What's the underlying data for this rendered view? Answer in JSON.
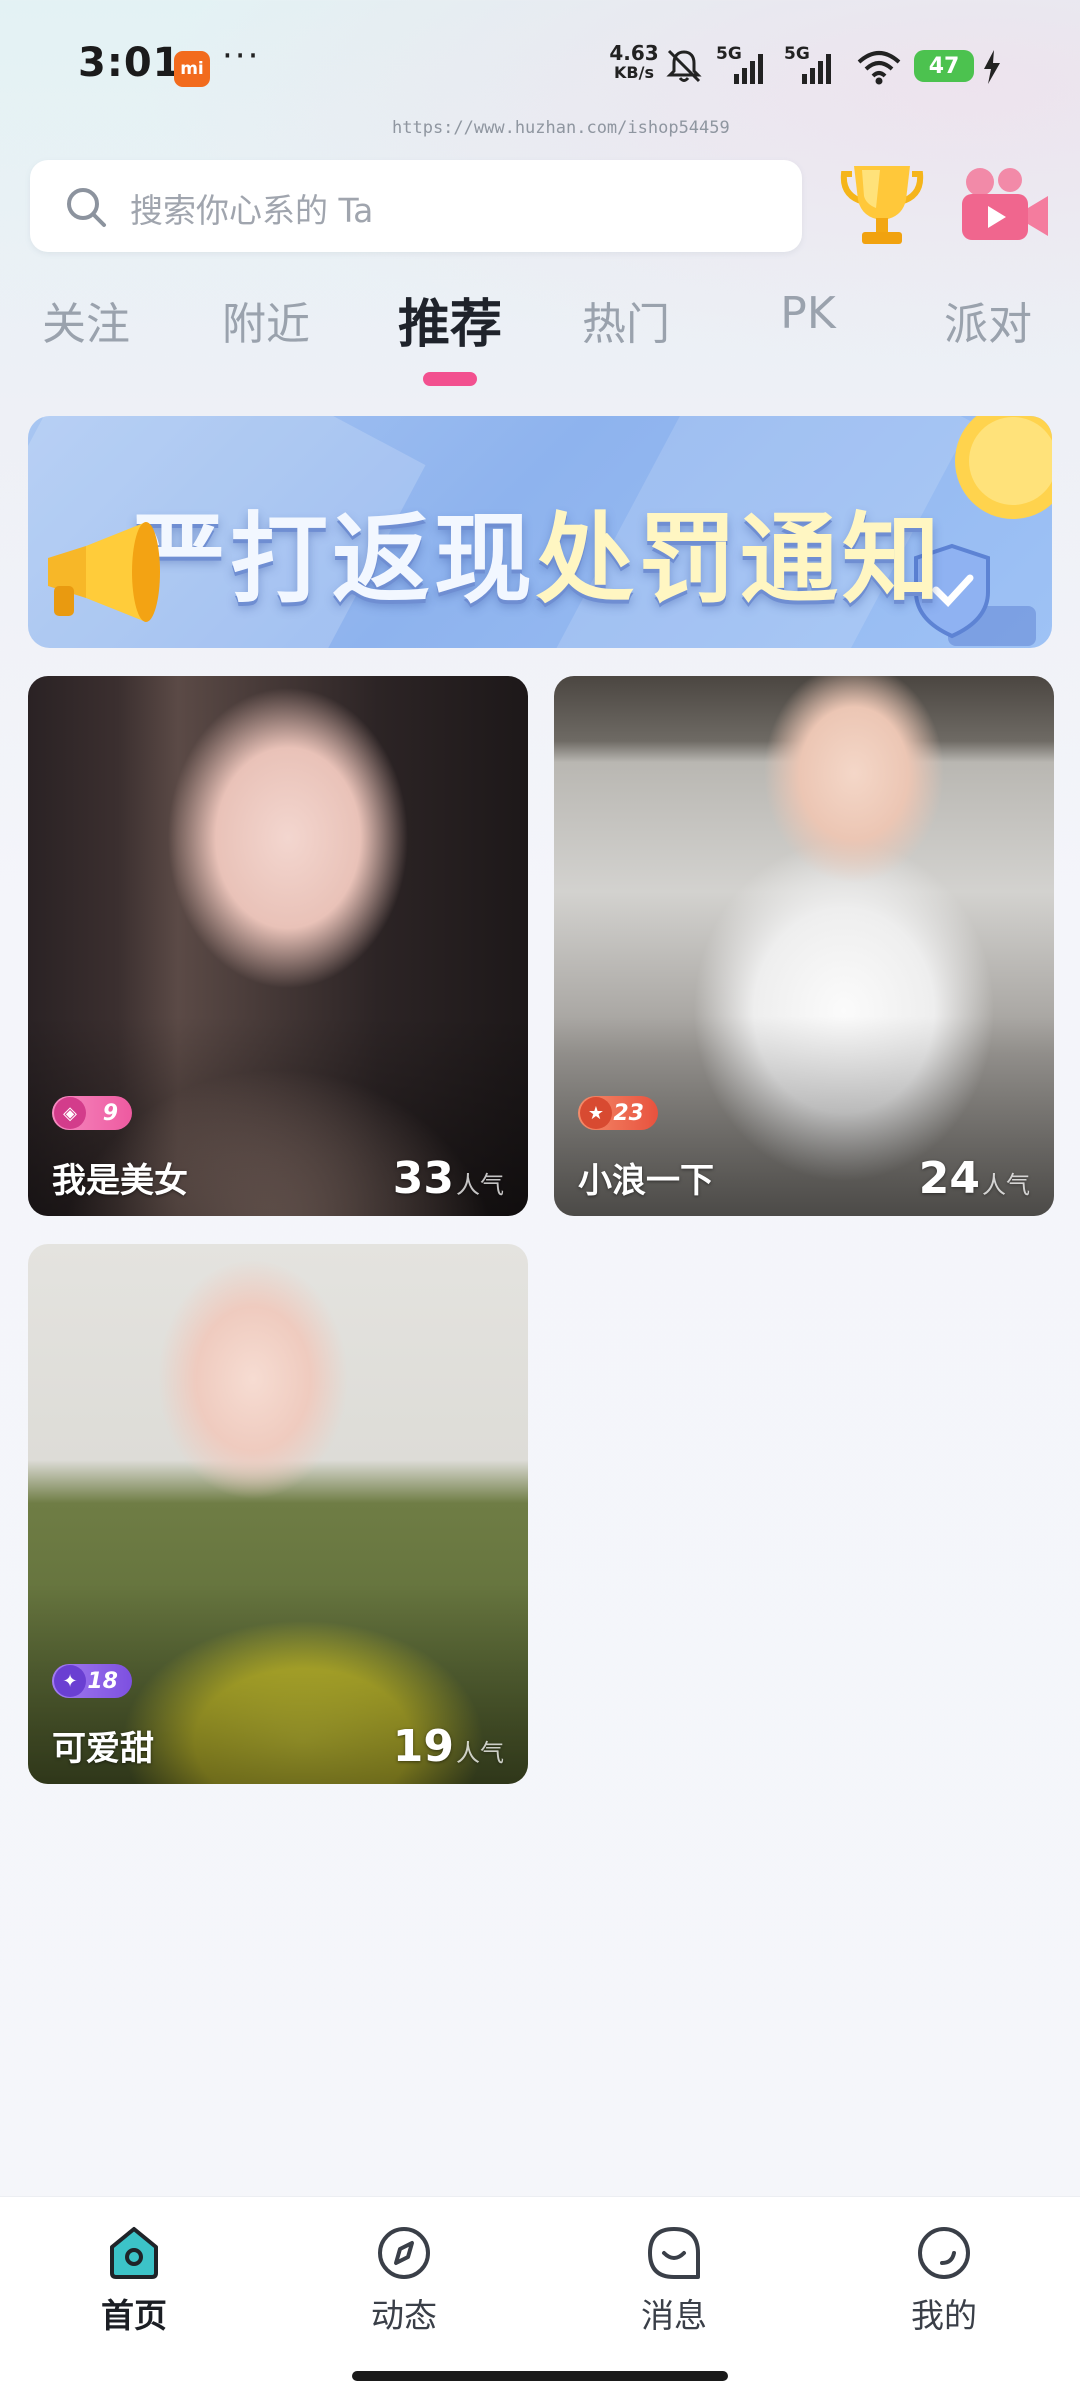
{
  "status_bar": {
    "time": "3:01",
    "mi_badge": "mi",
    "more": "···",
    "net_speed_value": "4.63",
    "net_speed_unit": "KB/s",
    "sim1_label": "5G",
    "sim2_label": "5G",
    "battery": "47"
  },
  "watermark_url": "https://www.huzhan.com/ishop54459",
  "search": {
    "placeholder": "搜索你心系的 Ta",
    "icon": "search-icon"
  },
  "header_actions": {
    "trophy_icon": "trophy-icon",
    "video_icon": "video-camera-icon"
  },
  "tabs": [
    {
      "label": "关注",
      "active": false
    },
    {
      "label": "附近",
      "active": false
    },
    {
      "label": "推荐",
      "active": true
    },
    {
      "label": "热门",
      "active": false
    },
    {
      "label": "PK",
      "active": false
    },
    {
      "label": "派对",
      "active": false
    }
  ],
  "banner": {
    "text_part1": "严打返现",
    "text_part2": "处罚通知"
  },
  "cards": [
    {
      "name": "我是美女",
      "level": "9",
      "popularity": "33",
      "popularity_unit": "人气"
    },
    {
      "name": "小浪一下",
      "level": "23",
      "popularity": "24",
      "popularity_unit": "人气"
    },
    {
      "name": "可爱甜",
      "level": "18",
      "popularity": "19",
      "popularity_unit": "人气"
    }
  ],
  "bottom_nav": [
    {
      "label": "首页",
      "icon": "home-icon",
      "active": true
    },
    {
      "label": "动态",
      "icon": "compass-icon",
      "active": false
    },
    {
      "label": "消息",
      "icon": "message-icon",
      "active": false
    },
    {
      "label": "我的",
      "icon": "profile-icon",
      "active": false
    }
  ],
  "colors": {
    "accent": "#f2508f",
    "home_active": "#3cc3c8"
  }
}
